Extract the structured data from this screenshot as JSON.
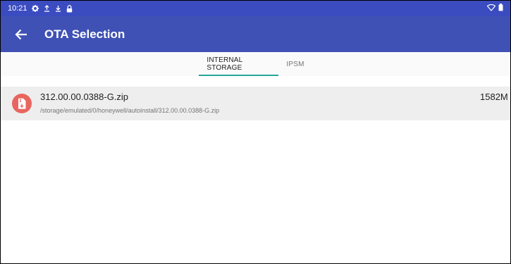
{
  "status_bar": {
    "time": "10:21",
    "icons": [
      "gear-icon",
      "upload-icon",
      "download-icon",
      "lock-icon"
    ],
    "right_icons": [
      "wifi-icon",
      "battery-icon"
    ]
  },
  "app_bar": {
    "title": "OTA Selection",
    "back_icon": "arrow-back-icon",
    "color": "#3f51b5"
  },
  "tabs": [
    {
      "label": "INTERNAL STORAGE",
      "selected": true
    },
    {
      "label": "IPSM",
      "selected": false
    }
  ],
  "accent_color": "#26a69a",
  "files": [
    {
      "name": "312.00.00.0388-G.zip",
      "path": "/storage/emulated/0/honeywell/autoinstall/312.00.00.0388-G.zip",
      "size": "1582M",
      "icon": "zip-file-icon"
    }
  ]
}
